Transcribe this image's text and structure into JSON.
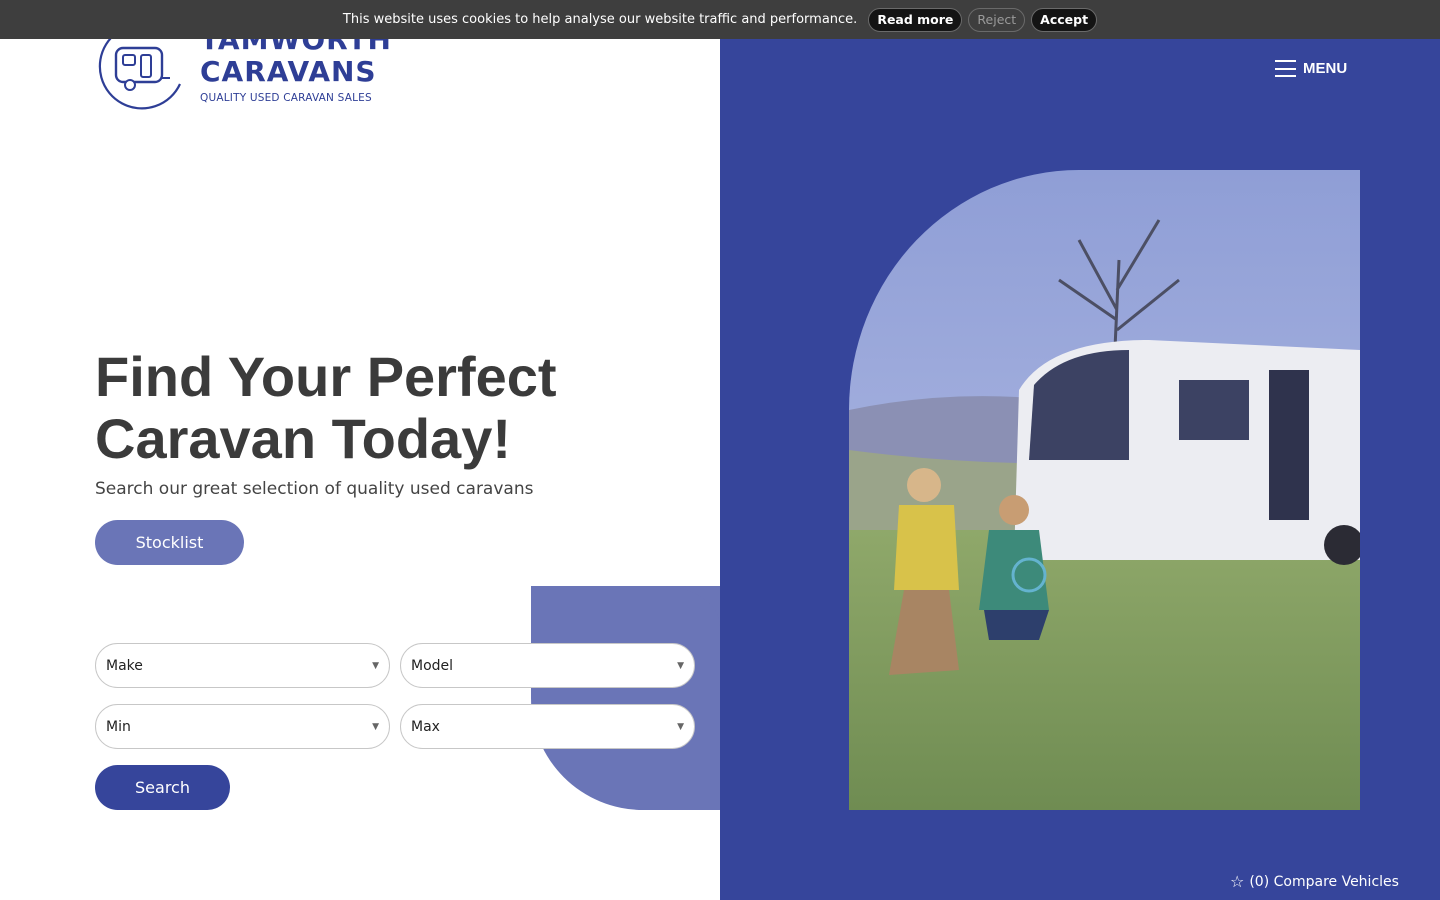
{
  "cookie": {
    "message": "This website uses cookies to help analyse our website traffic and performance.",
    "read_more": "Read more",
    "reject": "Reject",
    "accept": "Accept"
  },
  "logo": {
    "line1": "TAMWORTH",
    "line2": "CARAVANS",
    "tagline": "QUALITY USED CARAVAN SALES",
    "icon": "caravan-logo-icon"
  },
  "nav": {
    "menu_label": "MENU",
    "icon": "hamburger-icon"
  },
  "hero": {
    "title_line1": "Find Your Perfect",
    "title_line2": "Caravan Today!",
    "subtitle": "Search our great selection of quality used caravans",
    "stocklist_label": "Stocklist"
  },
  "search": {
    "make": "Make",
    "model": "Model",
    "min": "Min",
    "max": "Max",
    "button": "Search"
  },
  "compare": {
    "label": "(0) Compare Vehicles",
    "icon": "star-outline-icon"
  },
  "colors": {
    "brand_blue": "#36459b",
    "light_blue": "#6a75b7",
    "cookie_bg": "#3e3e3e"
  }
}
